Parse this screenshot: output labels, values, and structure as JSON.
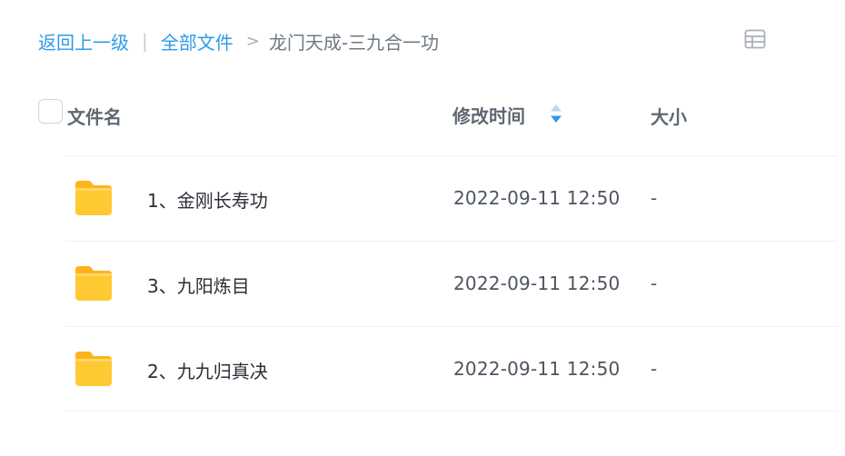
{
  "breadcrumb": {
    "back_label": "返回上一级",
    "separator": "|",
    "root_label": "全部文件",
    "arrow": ">",
    "current_label": "龙门天成-三九合一功"
  },
  "table": {
    "columns": {
      "name": "文件名",
      "modified": "修改时间",
      "size": "大小"
    },
    "sort": {
      "column": "modified",
      "direction": "descending"
    },
    "rows": [
      {
        "icon": "folder-icon",
        "name": "1、金刚长寿功",
        "modified": "2022-09-11 12:50",
        "size": "-"
      },
      {
        "icon": "folder-icon",
        "name": "3、九阳炼目",
        "modified": "2022-09-11 12:50",
        "size": "-"
      },
      {
        "icon": "folder-icon",
        "name": "2、九九归真决",
        "modified": "2022-09-11 12:50",
        "size": "-"
      }
    ]
  },
  "colors": {
    "link": "#2e9be8",
    "folder": "#ffc233",
    "sort_active": "#2e9be8",
    "sort_inactive": "#b9d9f5"
  }
}
